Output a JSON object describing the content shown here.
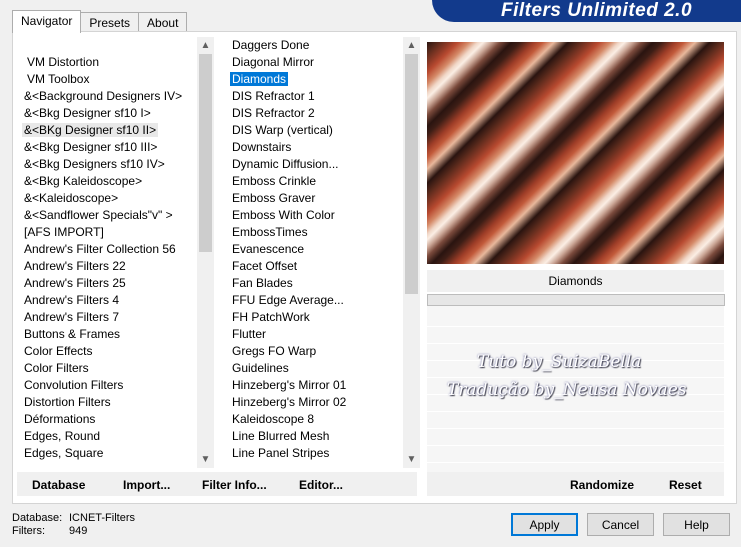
{
  "banner": {
    "title": "Filters Unlimited 2.0"
  },
  "tabs": [
    {
      "label": "Navigator",
      "active": true
    },
    {
      "label": "Presets",
      "active": false
    },
    {
      "label": "About",
      "active": false
    }
  ],
  "categories": [
    "VM Distortion",
    "VM Toolbox",
    "&<Background Designers IV>",
    "&<Bkg Designer sf10 I>",
    "&<BKg Designer sf10 II>",
    "&<Bkg Designer sf10 III>",
    "&<Bkg Designers sf10 IV>",
    "&<Bkg Kaleidoscope>",
    "&<Kaleidoscope>",
    "&<Sandflower Specials\"v\" >",
    "[AFS IMPORT]",
    "Andrew's Filter Collection 56",
    "Andrew's Filters 22",
    "Andrew's Filters 25",
    "Andrew's Filters 4",
    "Andrew's Filters 7",
    "Buttons & Frames",
    "Color Effects",
    "Color Filters",
    "Convolution Filters",
    "Distortion Filters",
    "Déformations",
    "Edges, Round",
    "Edges, Square"
  ],
  "filters": [
    "Daggers Done",
    "Diagonal Mirror",
    "Diamonds",
    "DIS Refractor 1",
    "DIS Refractor 2",
    "DIS Warp (vertical)",
    "Downstairs",
    "Dynamic Diffusion...",
    "Emboss Crinkle",
    "Emboss Graver",
    "Emboss With Color",
    "EmbossTimes",
    "Evanescence",
    "Facet Offset",
    "Fan Blades",
    "FFU Edge Average...",
    "FH PatchWork",
    "Flutter",
    "Gregs FO Warp",
    "Guidelines",
    "Hinzeberg's Mirror 01",
    "Hinzeberg's Mirror 02",
    "Kaleidoscope 8",
    "Line Blurred Mesh",
    "Line Panel Stripes"
  ],
  "selected_filter": "Diamonds",
  "hover_category": "&<BKg Designer sf10 II>",
  "grip_filters": [
    "DIS Refractor 2",
    "Flutter",
    "Guidelines"
  ],
  "preview": {
    "filter_name": "Diamonds"
  },
  "watermark": {
    "line1": "Tuto by_SuizaBella",
    "line2": "Tradução by_Neusa Novaes"
  },
  "panel_buttons": {
    "database": "Database",
    "import": "Import...",
    "filter_info": "Filter Info...",
    "editor": "Editor...",
    "randomize": "Randomize",
    "reset": "Reset"
  },
  "status": {
    "database_label": "Database:",
    "database_value": "ICNET-Filters",
    "filters_label": "Filters:",
    "filters_value": "949"
  },
  "dialog_buttons": {
    "apply": "Apply",
    "cancel": "Cancel",
    "help": "Help"
  }
}
